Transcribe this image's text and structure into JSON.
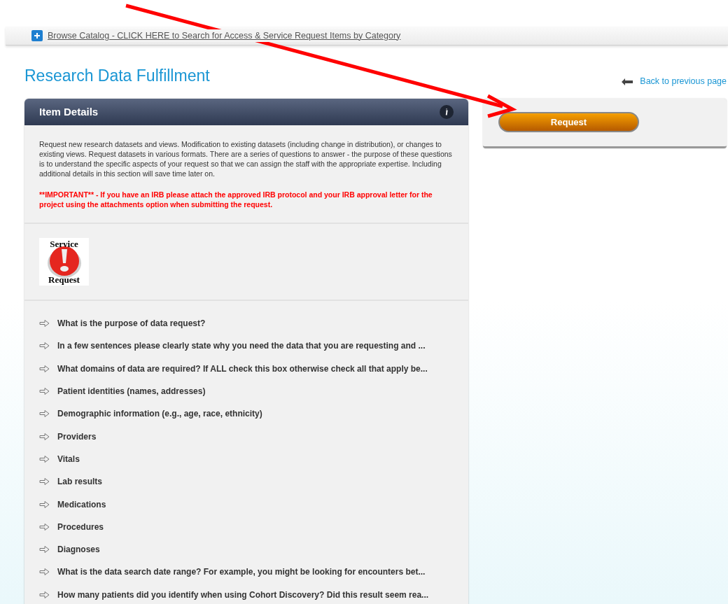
{
  "top_bar": {
    "link": "Browse Catalog - CLICK HERE to Search for Access & Service Request Items by Category"
  },
  "page_title": "Research Data Fulfillment",
  "back_link": "Back to previous page",
  "item_details": {
    "title": "Item Details",
    "description": "Request new research datasets and views. Modification to existing datasets (including change in distribution), or changes to existing views. Request datasets in various formats.  There are a series of questions to answer - the purpose of these questions is to understand the specific aspects of your request so that we can assign the staff with the appropriate expertise.  Including additional details in this section will save time later on.",
    "important": "**IMPORTANT** - If you have an IRB please attach the approved IRB protocol and your IRB approval letter for the project using the attachments option when submitting the request.",
    "logo": {
      "top_text": "Service",
      "bottom_text": "Request"
    },
    "questions": [
      "What is the purpose of data request?",
      "In a few sentences please clearly state why you need the data that you are requesting and ...",
      "What domains of data are required?  If ALL check this box otherwise check all that apply be...",
      "Patient identities (names, addresses)",
      "Demographic information (e.g., age, race, ethnicity)",
      "Providers",
      "Vitals",
      "Lab results",
      "Medications",
      "Procedures",
      "Diagnoses",
      "What is the data search date range?  For example, you might be looking for encounters bet...",
      "How many patients did you identify when using Cohort Discovery?  Did this result seem rea..."
    ]
  },
  "request_button": "Request"
}
